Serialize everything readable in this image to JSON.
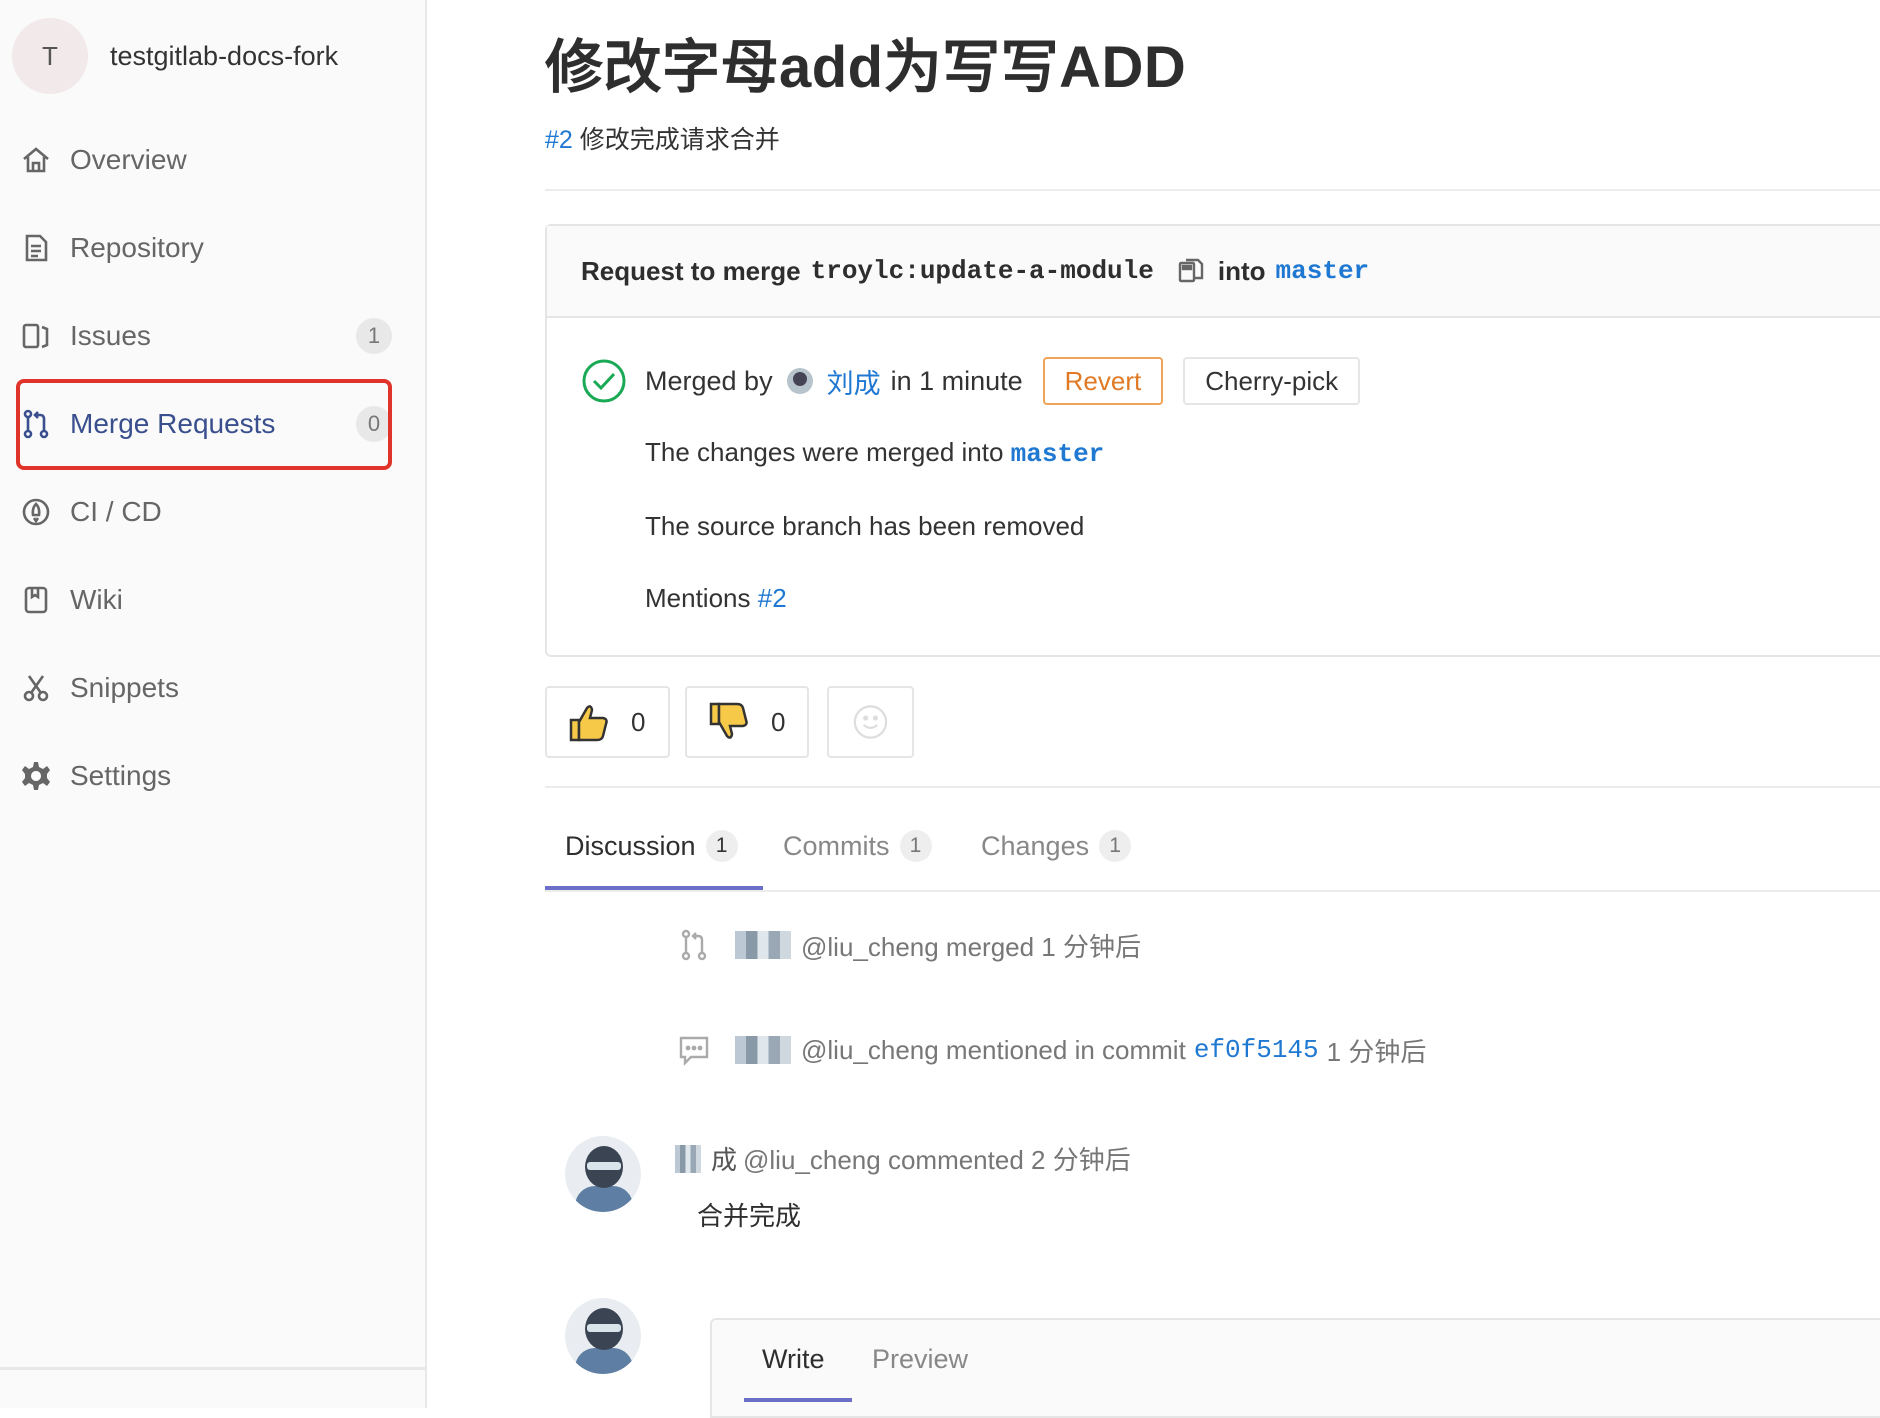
{
  "project": {
    "avatar_letter": "T",
    "name": "testgitlab-docs-fork"
  },
  "sidebar": {
    "items": [
      {
        "label": "Overview",
        "icon": "home-icon"
      },
      {
        "label": "Repository",
        "icon": "repository-icon"
      },
      {
        "label": "Issues",
        "icon": "issues-icon",
        "count": "1"
      },
      {
        "label": "Merge Requests",
        "icon": "merge-request-icon",
        "count": "0",
        "active": true
      },
      {
        "label": "CI / CD",
        "icon": "rocket-icon"
      },
      {
        "label": "Wiki",
        "icon": "book-icon"
      },
      {
        "label": "Snippets",
        "icon": "scissors-icon"
      },
      {
        "label": "Settings",
        "icon": "gear-icon"
      }
    ]
  },
  "merge_request": {
    "title": "修改字母add为写写ADD",
    "ref": "#2",
    "description": "修改完成请求合并",
    "request_prefix": "Request to merge",
    "source_branch": "troylc:update-a-module",
    "into_label": "into",
    "target_branch": "master",
    "merged_by_label": "Merged by",
    "merged_by_user": "刘成",
    "merged_time": "in 1 minute",
    "revert_label": "Revert",
    "cherry_pick_label": "Cherry-pick",
    "changes_merged_prefix": "The changes were merged into",
    "changes_merged_branch": "master",
    "source_removed": "The source branch has been removed",
    "mentions_label": "Mentions",
    "mentions_ref": "#2"
  },
  "awards": {
    "thumbs_up_count": "0",
    "thumbs_down_count": "0"
  },
  "tabs": [
    {
      "label": "Discussion",
      "count": "1"
    },
    {
      "label": "Commits",
      "count": "1"
    },
    {
      "label": "Changes",
      "count": "1"
    }
  ],
  "notes": [
    {
      "text": "@liu_cheng merged 1 分钟后",
      "icon": "merge-icon"
    },
    {
      "prefix": "@liu_cheng mentioned in commit",
      "commit": "ef0f5145",
      "suffix": "1 分钟后",
      "icon": "comment-icon"
    }
  ],
  "comment": {
    "name_suffix": "成",
    "header": "@liu_cheng commented 2 分钟后",
    "body": "合并完成"
  },
  "reply": {
    "write_tab": "Write",
    "preview_tab": "Preview"
  },
  "colors": {
    "link": "#1f78d1",
    "active_nav": "#3a4f8e",
    "highlight": "#e0332a",
    "success": "#1aaa55",
    "revert": "#e07a26",
    "tab_underline": "#6b6fc8"
  }
}
